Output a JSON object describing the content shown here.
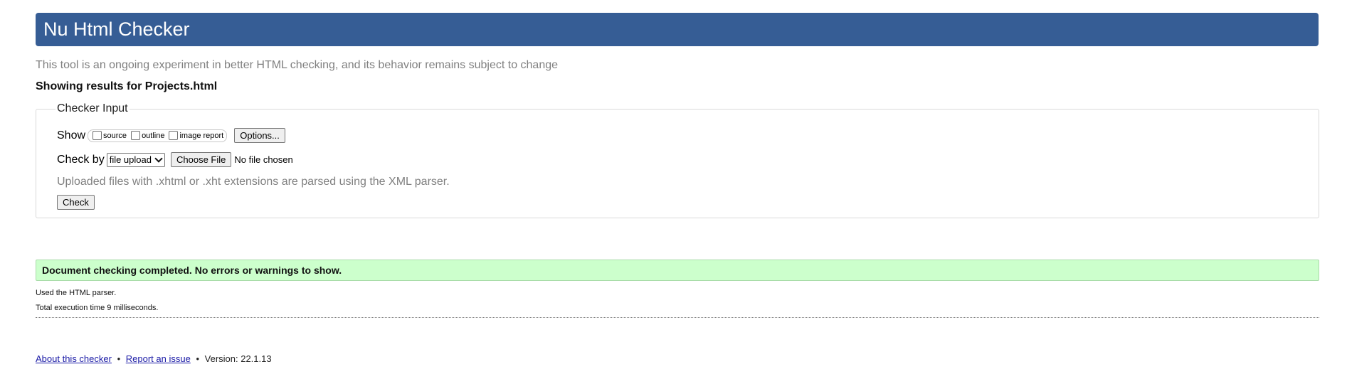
{
  "header": {
    "title": "Nu Html Checker"
  },
  "intro": {
    "text": "This tool is an ongoing experiment in better HTML checking, and its behavior remains subject to change"
  },
  "results_for": {
    "text": "Showing results for Projects.html"
  },
  "checker_input": {
    "legend": "Checker Input",
    "show_label": "Show",
    "show_options": [
      {
        "label": "source",
        "checked": false
      },
      {
        "label": "outline",
        "checked": false
      },
      {
        "label": "image report",
        "checked": false
      }
    ],
    "options_button": "Options...",
    "check_by_label": "Check by",
    "check_by_selected": "file upload",
    "choose_file_button": "Choose File",
    "no_file_text": "No file chosen",
    "xml_note": "Uploaded files with .xhtml or .xht extensions are parsed using the XML parser.",
    "check_button": "Check"
  },
  "result": {
    "status": "Document checking completed. No errors or warnings to show.",
    "parser_note": "Used the HTML parser.",
    "execution_time": "Total execution time 9 milliseconds."
  },
  "footer": {
    "about_link": "About this checker",
    "separator": "•",
    "report_link": "Report an issue",
    "version": "Version: 22.1.13"
  },
  "colors": {
    "header_bg": "#365d95",
    "success_bg": "#ccffcc",
    "muted_text": "#808080",
    "link": "#1a1aa6"
  }
}
